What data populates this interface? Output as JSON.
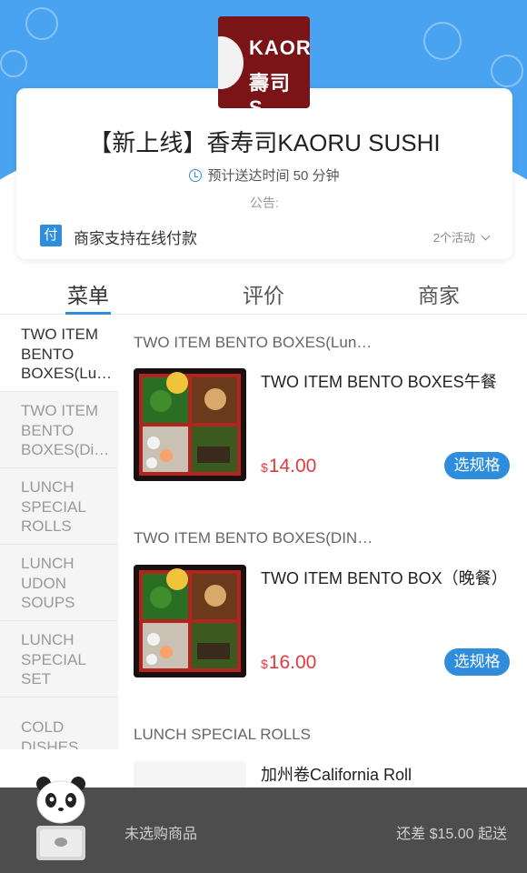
{
  "shop": {
    "logo_line1": "KAORU",
    "logo_line2": "壽司 S",
    "title": "【新上线】香寿司KAORU SUSHI",
    "delivery_time": "预计送达时间 50 分钟",
    "notice_label": "公告:",
    "pay_badge": "付",
    "pay_text": "商家支持在线付款",
    "activity_count": "2个活动"
  },
  "tabs": [
    {
      "label": "菜单",
      "active": true
    },
    {
      "label": "评价",
      "active": false
    },
    {
      "label": "商家",
      "active": false
    }
  ],
  "sidebar": {
    "items": [
      {
        "label": "TWO ITEM BENTO BOXES(Lu…",
        "active": true
      },
      {
        "label": "TWO ITEM BENTO BOXES(Di…",
        "active": false
      },
      {
        "label": "LUNCH SPECIAL ROLLS",
        "active": false
      },
      {
        "label": "LUNCH UDON SOUPS",
        "active": false
      },
      {
        "label": "LUNCH SPECIAL SET",
        "active": false
      },
      {
        "label": "COLD DISHES",
        "active": false
      }
    ]
  },
  "menu": {
    "sections": [
      {
        "title": "TWO ITEM BENTO BOXES(Lun…",
        "items": [
          {
            "name": "TWO ITEM BENTO BOXES午餐",
            "currency": "$",
            "price": "14.00",
            "button": "选规格"
          }
        ]
      },
      {
        "title": "TWO ITEM BENTO BOXES(DIN…",
        "items": [
          {
            "name": "TWO ITEM BENTO BOX（晚餐）",
            "currency": "$",
            "price": "16.00",
            "button": "选规格"
          }
        ]
      },
      {
        "title": "LUNCH SPECIAL ROLLS",
        "items": [
          {
            "name": "加州卷California Roll"
          }
        ]
      }
    ]
  },
  "cart": {
    "empty_text": "未选购商品",
    "min_order_text": "还差 $15.00 起送"
  },
  "colors": {
    "brand_blue": "#2e8ddc",
    "price_red": "#e4393c",
    "cart_bar": "#4d4d4d"
  }
}
